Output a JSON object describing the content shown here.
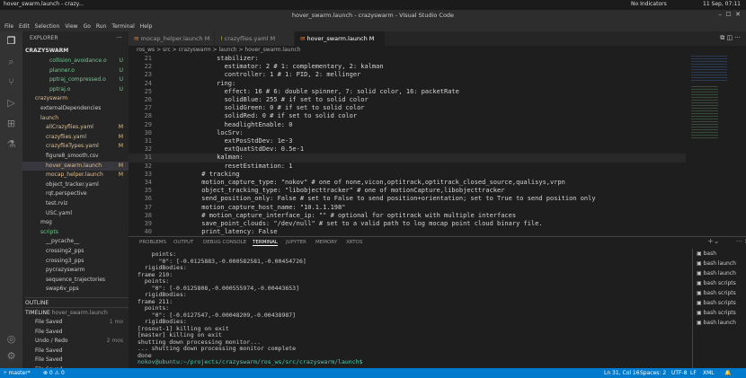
{
  "topbar": {
    "app_tab": "hover_swarm.launch - crazy...",
    "indicators": "No Indicators",
    "date": "11 Sep, 07:11"
  },
  "window_title": "hover_swarm.launch - crazyswarm - Visual Studio Code",
  "menu": [
    "File",
    "Edit",
    "Selection",
    "View",
    "Go",
    "Run",
    "Terminal",
    "Help"
  ],
  "explorer": {
    "title": "EXPLORER",
    "root": "CRAZYSWARM",
    "rows": [
      {
        "label": "collision_avoidance.o",
        "badge": "U",
        "color": "#73c991"
      },
      {
        "label": "planner.o",
        "badge": "U",
        "color": "#73c991"
      },
      {
        "label": "pptraj_compressed.o",
        "badge": "U",
        "color": "#73c991"
      },
      {
        "label": "pptraj.o",
        "badge": "U",
        "color": "#73c991"
      },
      {
        "label": "crazyswarm",
        "badge": "",
        "color": "#e2c08d"
      },
      {
        "label": "externalDependencies",
        "badge": "",
        "color": "#ccc"
      },
      {
        "label": "launch",
        "badge": "",
        "color": "#e2c08d"
      },
      {
        "label": "allCrazyflies.yaml",
        "badge": "M",
        "color": "#e2c08d"
      },
      {
        "label": "crazyflies.yaml",
        "badge": "M",
        "color": "#e2c08d"
      },
      {
        "label": "crazyflieTypes.yaml",
        "badge": "M",
        "color": "#e2c08d"
      },
      {
        "label": "figure8_smooth.csv",
        "badge": "",
        "color": "#ccc"
      },
      {
        "label": "hover_swarm.launch",
        "badge": "M",
        "color": "#e2c08d"
      },
      {
        "label": "mocap_helper.launch",
        "badge": "M",
        "color": "#e2c08d"
      },
      {
        "label": "object_tracker.yaml",
        "badge": "",
        "color": "#ccc"
      },
      {
        "label": "rqt.perspective",
        "badge": "",
        "color": "#ccc"
      },
      {
        "label": "test.rviz",
        "badge": "",
        "color": "#ccc"
      },
      {
        "label": "USC.yaml",
        "badge": "",
        "color": "#ccc"
      },
      {
        "label": "msg",
        "badge": "",
        "color": "#ccc"
      },
      {
        "label": "scripts",
        "badge": "",
        "color": "#73c991"
      },
      {
        "label": "__pycache__",
        "badge": "",
        "color": "#ccc"
      },
      {
        "label": "crossing2_pps",
        "badge": "",
        "color": "#ccc"
      },
      {
        "label": "crossing3_pps",
        "badge": "",
        "color": "#ccc"
      },
      {
        "label": "pycrazyswarm",
        "badge": "",
        "color": "#ccc"
      },
      {
        "label": "sequence_trajectories",
        "badge": "",
        "color": "#ccc"
      },
      {
        "label": "swap6v_pps",
        "badge": "",
        "color": "#ccc"
      }
    ],
    "outline": "OUTLINE",
    "timeline": "TIMELINE",
    "timeline_file": "hover_swarm.launch",
    "timeline_rows": [
      {
        "label": "File Saved",
        "time": "1 mo"
      },
      {
        "label": "File Saved",
        "time": ""
      },
      {
        "label": "Undo / Redo",
        "time": "2 mos"
      },
      {
        "label": "File Saved",
        "time": ""
      },
      {
        "label": "File Saved",
        "time": ""
      },
      {
        "label": "File Saved",
        "time": ""
      }
    ]
  },
  "tabs": [
    {
      "label": "mocap_helper.launch  M"
    },
    {
      "label": "crazyflies.yaml  M"
    },
    {
      "label": "hover_swarm.launch  M"
    }
  ],
  "breadcrumb": "ros_ws > src > crazyswarm > launch > hover_swarm.launch",
  "code": [
    {
      "n": "21",
      "t": "          stabilizer:"
    },
    {
      "n": "22",
      "t": "            estimator: 2 # 1: complementary, 2: kalman"
    },
    {
      "n": "23",
      "t": "            controller: 1 # 1: PID, 2: mellinger"
    },
    {
      "n": "24",
      "t": "          ring:"
    },
    {
      "n": "25",
      "t": "            effect: 16 # 6: double spinner, 7: solid color, 16: packetRate"
    },
    {
      "n": "26",
      "t": "            solidBlue: 255 # if set to solid color"
    },
    {
      "n": "27",
      "t": "            solidGreen: 0 # if set to solid color"
    },
    {
      "n": "28",
      "t": "            solidRed: 0 # if set to solid color"
    },
    {
      "n": "29",
      "t": "            headlightEnable: 0"
    },
    {
      "n": "30",
      "t": "          locSrv:"
    },
    {
      "n": "31",
      "t": "            extPosStdDev: 1e-3"
    },
    {
      "n": "32",
      "t": "            extQuatStdDev: 0.5e-1"
    },
    {
      "n": "31",
      "t": "          kalman:"
    },
    {
      "n": "32",
      "t": "            resetEstimation: 1"
    },
    {
      "n": "33",
      "t": "      # tracking"
    },
    {
      "n": "34",
      "t": "      motion_capture_type: \"nokov\" # one of none,vicon,optitrack,optitrack_closed_source,qualisys,vrpn"
    },
    {
      "n": "35",
      "t": "      object_tracking_type: \"libobjecttracker\" # one of motionCapture,libobjecttracker"
    },
    {
      "n": "36",
      "t": "      send_position_only: False # set to False to send position+orientation; set to True to send position only"
    },
    {
      "n": "37",
      "t": "      motion_capture_host_name: \"10.1.1.198\""
    },
    {
      "n": "38",
      "t": "      # motion_capture_interface_ip: \"\" # optional for optitrack with multiple interfaces"
    },
    {
      "n": "39",
      "t": "      save_point_clouds: \"/dev/null\" # set to a valid path to log mocap point cloud binary file."
    },
    {
      "n": "40",
      "t": "      print_latency: False"
    }
  ],
  "panel_tabs": [
    "PROBLEMS",
    "OUTPUT",
    "DEBUG CONSOLE",
    "TERMINAL",
    "JUPYTER",
    "MEMORY",
    "XRTOS"
  ],
  "terminal": [
    "    points:",
    "      \"0\": [-0.0125883,-0.000582581,-0.00454726]",
    "  rigidBodies:",
    "frame 210:",
    "  points:",
    "    \"0\": [-0.0125808,-0.000555974,-0.00443653]",
    "  rigidBodies:",
    "frame 211:",
    "  points:",
    "    \"0\": [-0.0127547,-0.00048209,-0.00438987]",
    "  rigidBodies:",
    "[rosout-1] killing on exit",
    "[master] killing on exit",
    "shutting down processing monitor...",
    "... shutting down processing monitor complete",
    "done",
    "nokov@ubuntu:~/projects/crazyswarm/ros_ws/src/crazyswarm/launch$ "
  ],
  "terminals": [
    "bash",
    "bash  launch",
    "bash  launch",
    "bash  scripts",
    "bash  scripts",
    "bash  scripts",
    "bash  scripts",
    "bash  launch"
  ],
  "status": {
    "branch": "master*",
    "errors": "⊗ 0 ⚠ 0",
    "pos": "Ln 31, Col 16",
    "spaces": "Spaces: 2",
    "enc": "UTF-8",
    "eol": "LF",
    "lang": "XML"
  }
}
